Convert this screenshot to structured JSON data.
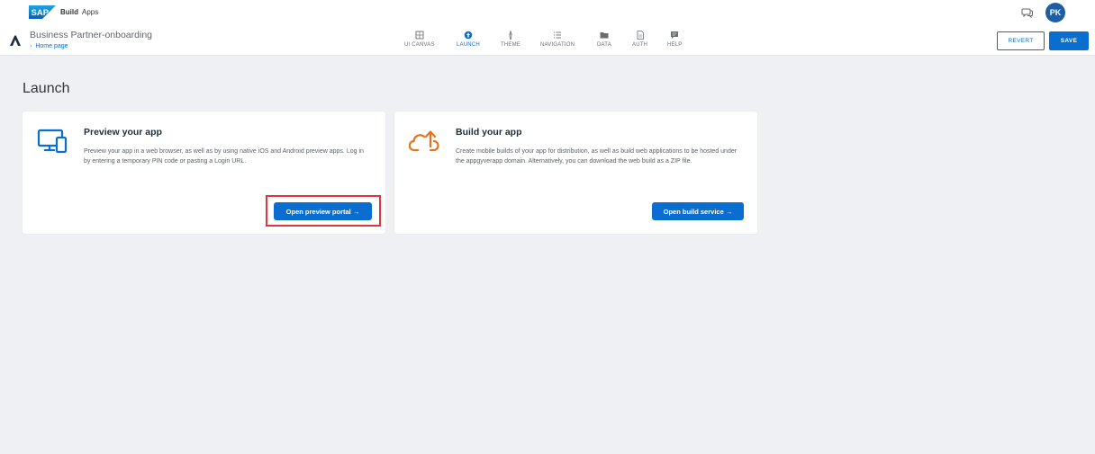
{
  "shell": {
    "logo_text": "SAP",
    "product": "Build",
    "section": "Apps",
    "user_initials": "PK"
  },
  "appbar": {
    "project_name": "Business Partner-onboarding",
    "breadcrumb": "Home page",
    "tabs": [
      {
        "label": "UI CANVAS",
        "icon": "canvas-icon",
        "active": false
      },
      {
        "label": "LAUNCH",
        "icon": "launch-icon",
        "active": true
      },
      {
        "label": "THEME",
        "icon": "brush-icon",
        "active": false
      },
      {
        "label": "NAVIGATION",
        "icon": "list-icon",
        "active": false
      },
      {
        "label": "DATA",
        "icon": "folder-icon",
        "active": false
      },
      {
        "label": "AUTH",
        "icon": "document-icon",
        "active": false
      },
      {
        "label": "HELP",
        "icon": "chat-icon",
        "active": false
      }
    ],
    "revert_label": "REVERT",
    "save_label": "SAVE"
  },
  "main": {
    "title": "Launch",
    "cards": [
      {
        "title": "Preview your app",
        "description": "Preview your app in a web browser, as well as by using native iOS and Android preview apps. Log in by entering a temporary PIN code or pasting a Login URL.",
        "button_label": "Open preview portal →",
        "icon": "devices-icon"
      },
      {
        "title": "Build your app",
        "description": "Create mobile builds of your app for distribution, as well as build web applications to be hosted under the appgyverapp domain. Alternatively, you can download the web build as a ZIP file.",
        "button_label": "Open build service →",
        "icon": "cloud-upload-icon"
      }
    ]
  },
  "colors": {
    "accent": "#0a6ed1",
    "highlight": "#e0353c",
    "build_icon": "#e8731f"
  }
}
